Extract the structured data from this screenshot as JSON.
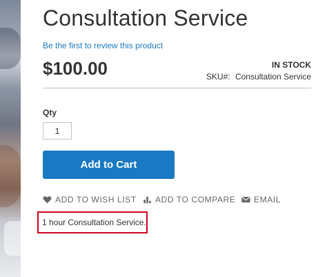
{
  "product": {
    "title": "Consultation Service",
    "review_link": "Be the first to review this product",
    "price": "$100.00",
    "stock_status": "IN STOCK",
    "sku_label": "SKU#:",
    "sku_value": "Consultation Service",
    "description": "1 hour Consultation Service."
  },
  "form": {
    "qty_label": "Qty",
    "qty_value": "1",
    "add_to_cart_label": "Add to Cart"
  },
  "actions": {
    "wishlist_label": "ADD TO WISH LIST",
    "compare_label": "ADD TO COMPARE",
    "email_label": "EMAIL"
  },
  "colors": {
    "primary": "#1979c3",
    "highlight": "#d0021b",
    "text": "#333333",
    "muted": "#666666"
  }
}
